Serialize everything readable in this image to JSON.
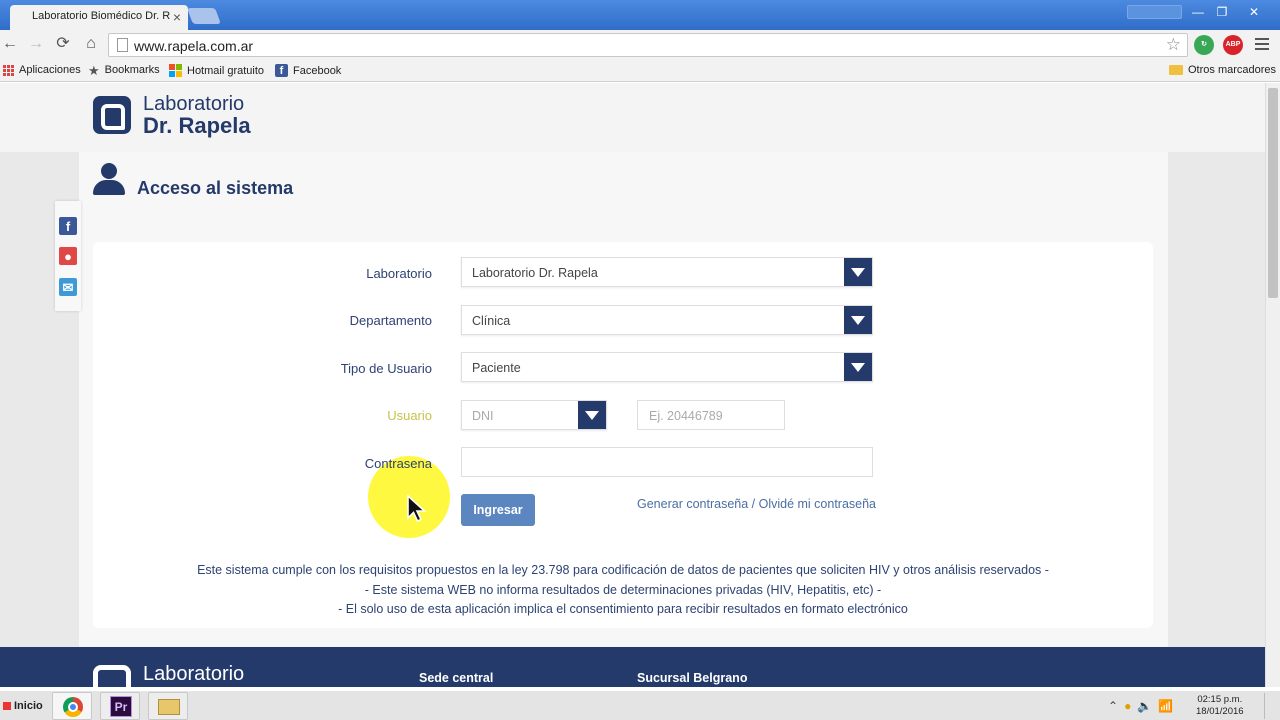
{
  "browser": {
    "tab_title": "Laboratorio Biomédico Dr. R",
    "tab_close": "×",
    "window_controls": {
      "minimize": "—",
      "restore": "❐",
      "close": "✕"
    },
    "url": "www.rapela.com.ar",
    "nav": {
      "back": "←",
      "forward": "→",
      "reload": "⟳",
      "home": "⌂"
    },
    "star": "☆",
    "extensions": [
      {
        "name": "refresh-extension",
        "color": "#3aa757"
      },
      {
        "name": "adblock-plus",
        "label": "ABP",
        "color": "#d9232a"
      }
    ]
  },
  "bookmarks": {
    "apps": "Aplicaciones",
    "bookmarks": "Bookmarks",
    "hotmail": "Hotmail gratuito",
    "facebook": "Facebook",
    "other": "Otros marcadores"
  },
  "site": {
    "logo": {
      "line1": "Laboratorio",
      "line2": "Dr. Rapela"
    },
    "section_title": "Acceso al sistema",
    "social": [
      {
        "icon": "facebook-icon",
        "glyph": "f",
        "color": "#3b5998"
      },
      {
        "icon": "map-pin-icon",
        "glyph": "●",
        "color": "#e04848"
      },
      {
        "icon": "mail-icon",
        "glyph": "✉",
        "color": "#3d9ad6"
      }
    ],
    "form": {
      "laboratorio": {
        "label": "Laboratorio",
        "value": "Laboratorio Dr. Rapela"
      },
      "departamento": {
        "label": "Departamento",
        "value": "Clínica"
      },
      "tipo_usuario": {
        "label": "Tipo de Usuario",
        "value": "Paciente"
      },
      "usuario": {
        "label": "Usuario",
        "doc_type": "DNI",
        "placeholder": "Ej. 20446789"
      },
      "contrasena": {
        "label": "Contrasena",
        "value": ""
      },
      "submit": "Ingresar",
      "forgot_link": "Generar contraseña / Olvidé mi contraseña"
    },
    "notice": [
      "Este sistema cumple con los requisitos propuestos en la ley 23.798 para codificación de datos de pacientes que soliciten HIV y otros análisis reservados -",
      "- Este sistema WEB no informa resultados de determinaciones privadas (HIV, Hepatitis, etc) -",
      "- El solo uso de esta aplicación implica el consentimiento para recibir resultados en formato electrónico"
    ],
    "footer": {
      "logo_line1": "Laboratorio",
      "col1": "Sede central",
      "col2": "Sucursal Belgrano"
    }
  },
  "taskbar": {
    "start": "Inicio",
    "apps": [
      "chrome-icon",
      "premiere-icon",
      "explorer-folder-icon"
    ],
    "premiere_label": "Pr",
    "tray": {
      "expand": "⌃",
      "volume": "🔈",
      "network": "📶"
    },
    "time": "02:15 p.m.",
    "date": "18/01/2016"
  },
  "colors": {
    "brand_navy": "#243a6b",
    "button_blue": "#5b86c0",
    "link_blue": "#4a6fa5",
    "highlight_yellow": "#fff500"
  }
}
